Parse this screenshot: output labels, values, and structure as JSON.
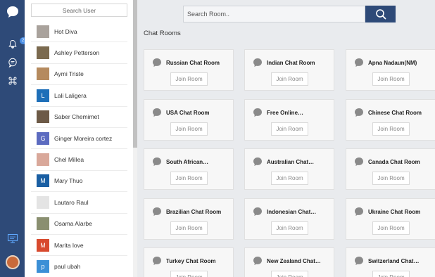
{
  "user_panel": {
    "search_placeholder": "Search User",
    "users": [
      {
        "name": "Hot Diva",
        "initial": "",
        "color": "#a9a29c"
      },
      {
        "name": "Ashley Petterson",
        "initial": "",
        "color": "#7b6a4f"
      },
      {
        "name": "Aymi Triste",
        "initial": "",
        "color": "#b58a5e"
      },
      {
        "name": "Lali Laligera",
        "initial": "L",
        "color": "#1e6fb8"
      },
      {
        "name": "Saber Chemimet",
        "initial": "",
        "color": "#6d5a47"
      },
      {
        "name": "Ginger Moreira cortez",
        "initial": "G",
        "color": "#5c6bc0"
      },
      {
        "name": "Chel Millea",
        "initial": "",
        "color": "#d9a89a"
      },
      {
        "name": "Mary Thuo",
        "initial": "M",
        "color": "#1a5fa3"
      },
      {
        "name": "Lautaro Raul",
        "initial": "",
        "color": "#e4e4e4"
      },
      {
        "name": "Osama Alarbe",
        "initial": "",
        "color": "#8a8f70"
      },
      {
        "name": "Marita love",
        "initial": "M",
        "color": "#d84a2e"
      },
      {
        "name": "paul ubah",
        "initial": "p",
        "color": "#3b8fd6"
      }
    ]
  },
  "rail": {
    "notification_count": "2",
    "icons": [
      "chat-logo-icon",
      "bell-icon",
      "messages-icon",
      "command-icon",
      "screen-icon"
    ]
  },
  "main": {
    "search_placeholder": "Search Room..",
    "section_title": "Chat Rooms",
    "join_label": "Join Room",
    "rooms": [
      "Russian Chat Room",
      "Indian Chat Room",
      "Apna Nadaun(NM)",
      "USA Chat Room",
      "Free Online…",
      "Chinese Chat Room",
      "South African…",
      "Australian Chat…",
      "Canada Chat Room",
      "Brazilian Chat Room",
      "Indonesian Chat…",
      "Ukraine Chat Room",
      "Turkey Chat Room",
      "New Zealand Chat…",
      "Switzerland Chat…"
    ]
  },
  "colors": {
    "rail_bg": "#2e4a78",
    "accent": "#2e4a78",
    "page_bg": "#e9ebee",
    "card_bg": "#f7f7f7"
  }
}
